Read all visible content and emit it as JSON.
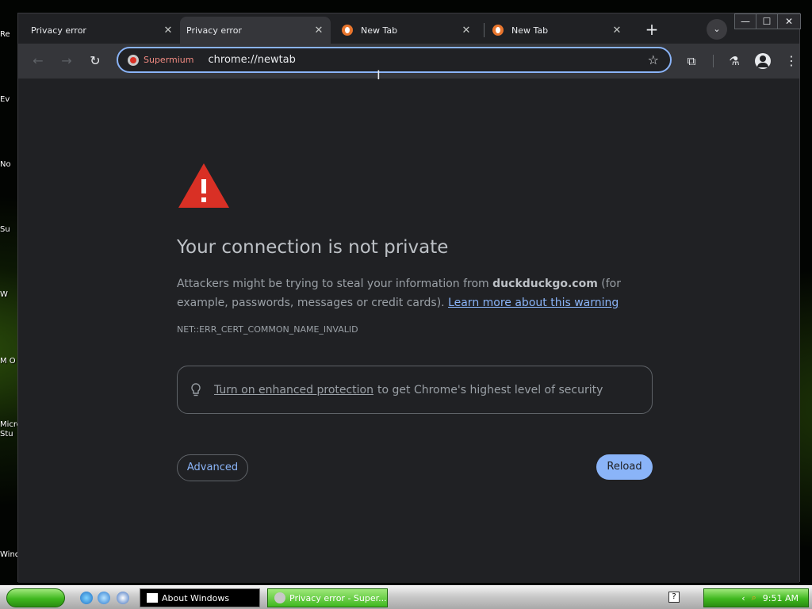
{
  "desktop": {
    "icons": [
      "Re",
      "Ev",
      "No",
      "Su",
      "W",
      "M O",
      "Micro Stu",
      "Wind"
    ]
  },
  "browser": {
    "tabs": [
      {
        "title": "Privacy error",
        "active": false
      },
      {
        "title": "Privacy error",
        "active": true
      },
      {
        "title": "New Tab",
        "active": false
      },
      {
        "title": "New Tab",
        "active": false
      }
    ],
    "new_tab_icon": "plus-icon",
    "tab_search_icon": "chevron-down-icon",
    "window_controls": {
      "minimize": "—",
      "maximize": "☐",
      "close": "✕"
    },
    "toolbar": {
      "back_icon": "arrow-left-icon",
      "forward_icon": "arrow-right-icon",
      "reload_icon": "reload-icon",
      "site_label": "Supermium",
      "url": "chrome://newtab",
      "bookmark_icon": "star-icon"
    }
  },
  "page": {
    "heading": "Your connection is not private",
    "body_prefix": "Attackers might be trying to steal your information from",
    "domain": "duckduckgo.com",
    "body_suffix": "(for example, passwords, messages or credit cards).",
    "learn_more": "Learn more about this warning",
    "error_code": "NET::ERR_CERT_COMMON_NAME_INVALID",
    "enhanced_link": "Turn on enhanced protection",
    "enhanced_suffix": "to get Chrome's highest level of security",
    "advanced_button": "Advanced",
    "reload_button": "Reload",
    "colors": {
      "warning_red": "#d93025",
      "link_blue": "#8ab4f8",
      "background": "#202124"
    }
  },
  "taskbar": {
    "tasks": [
      "About Windows",
      "Privacy error - Super..."
    ],
    "clock": "9:51 AM"
  }
}
